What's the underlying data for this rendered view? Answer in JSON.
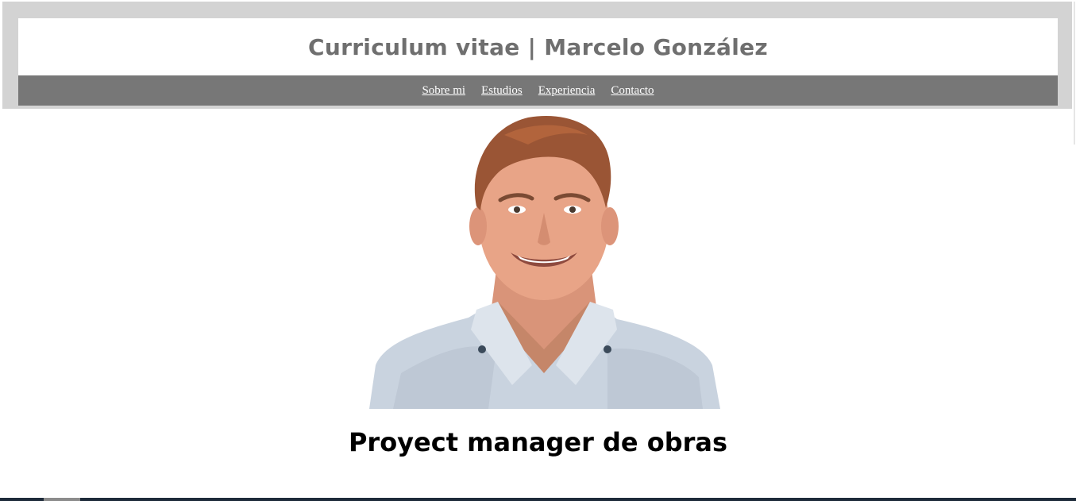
{
  "header": {
    "title": "Curriculum vitae | Marcelo González"
  },
  "nav": {
    "items": [
      {
        "label": "Sobre mi"
      },
      {
        "label": "Estudios"
      },
      {
        "label": "Experiencia"
      },
      {
        "label": "Contacto"
      }
    ]
  },
  "profile": {
    "job_title": "Proyect manager de obras"
  },
  "colors": {
    "header_frame": "#d3d3d3",
    "nav_background": "#777777",
    "title_text": "#6f6f6f",
    "shirt": "#c9d3df",
    "skin": "#e8a487",
    "hair": "#9a5535"
  }
}
